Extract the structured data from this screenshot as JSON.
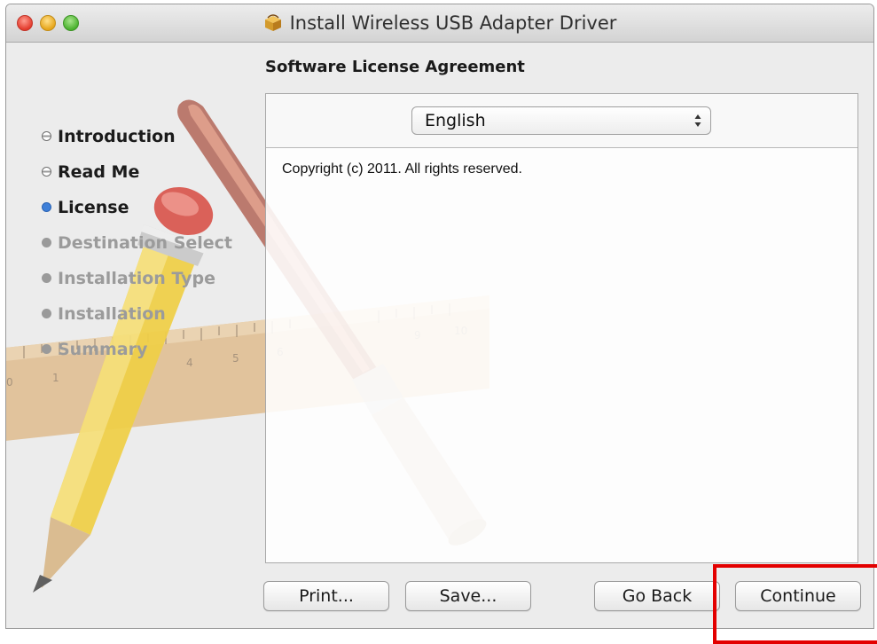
{
  "window": {
    "title": "Install Wireless USB Adapter Driver",
    "icon": "package-installer-icon"
  },
  "page_title": "Software License Agreement",
  "steps": [
    {
      "label": "Introduction",
      "state": "done"
    },
    {
      "label": "Read Me",
      "state": "done"
    },
    {
      "label": "License",
      "state": "current"
    },
    {
      "label": "Destination Select",
      "state": "future"
    },
    {
      "label": "Installation Type",
      "state": "future"
    },
    {
      "label": "Installation",
      "state": "future"
    },
    {
      "label": "Summary",
      "state": "future"
    }
  ],
  "language_select": {
    "value": "English"
  },
  "license_text": "Copyright (c) 2011.  All rights reserved.",
  "buttons": {
    "print": "Print...",
    "save": "Save...",
    "go_back": "Go Back",
    "continue": "Continue"
  },
  "ruler_numbers": [
    "0",
    "1",
    "4",
    "5",
    "6",
    "9",
    "10"
  ],
  "colors": {
    "highlight": "#e30000",
    "current_step": "#3e7fd8"
  }
}
